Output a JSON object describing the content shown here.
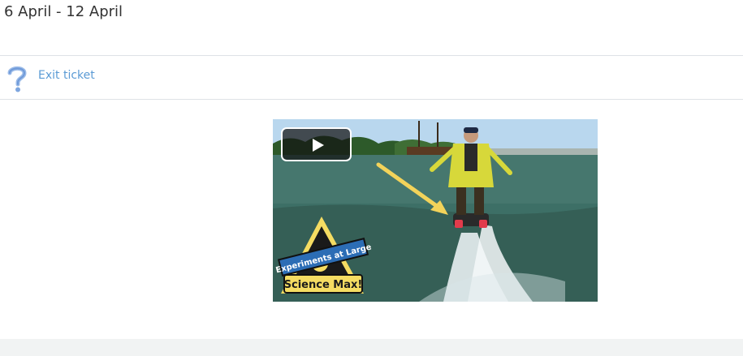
{
  "section": {
    "title": "6 April - 12 April"
  },
  "activity": {
    "icon": "question-mark-icon",
    "label": "Exit ticket"
  },
  "video": {
    "thumbnail_logo_line1": "Experiments at Large",
    "thumbnail_logo_line2": "Science Max!",
    "play_icon": "play-icon"
  },
  "colors": {
    "link": "#5b9bd5",
    "icon": "#8fb3e6",
    "divider": "#dee2e6",
    "footer": "#f1f3f3"
  }
}
